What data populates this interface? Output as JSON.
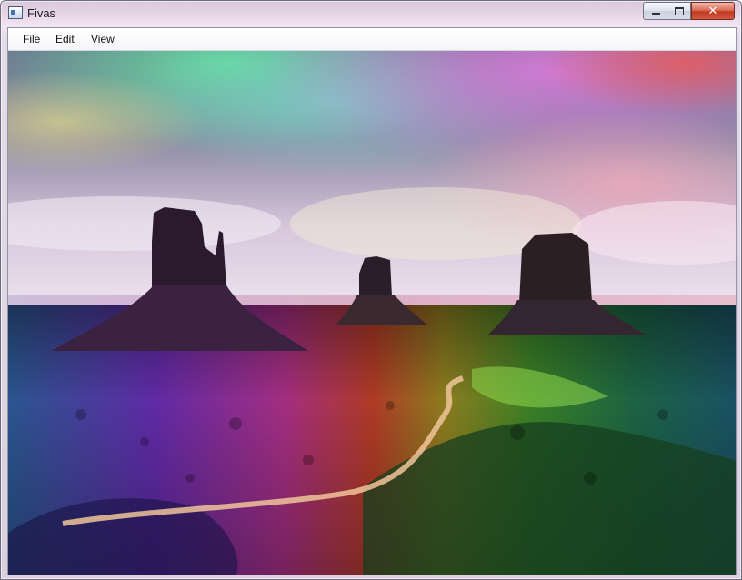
{
  "window": {
    "title": "Fivas",
    "controls": {
      "minimize": "—",
      "maximize": "□",
      "close": "✕"
    }
  },
  "menu": {
    "items": [
      "File",
      "Edit",
      "View"
    ]
  },
  "canvas": {
    "content": "rainbow-tinted desert landscape with three rock buttes"
  },
  "colors": {
    "window_frame": "#e6d4e6",
    "close_button": "#c13b22",
    "menu_text": "#111111"
  }
}
